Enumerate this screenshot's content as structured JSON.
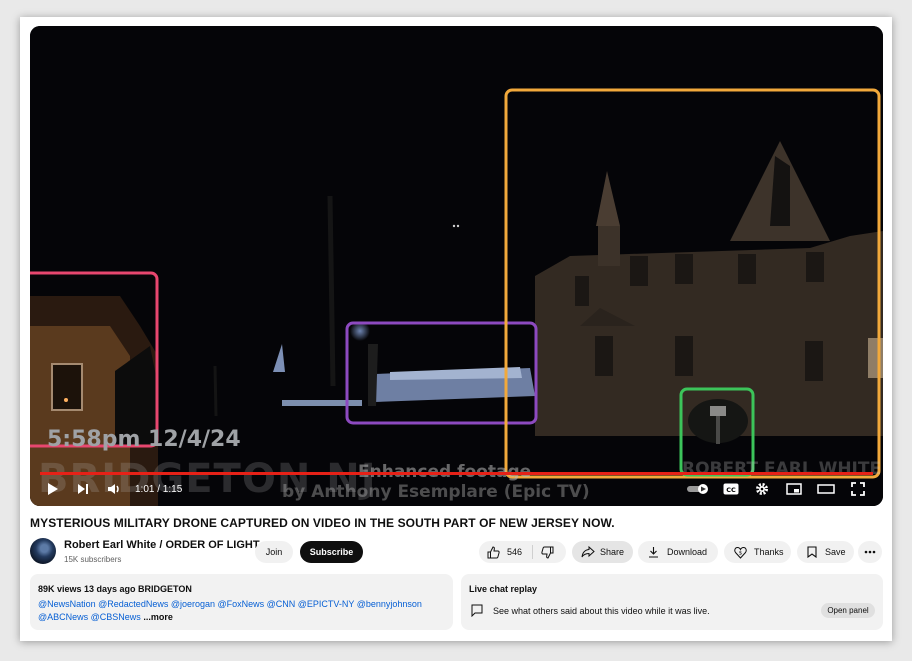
{
  "video": {
    "overlay_timestamp": "5:58pm 12/4/24",
    "overlay_location": "BRIDGETON NJ",
    "overlay_enhanced": "Enhanced footage",
    "overlay_credit": "by Anthony Esemplare (Epic TV)",
    "overlay_watermark": "ROBERT EARL WHITE",
    "time": "1:01 / 1:15",
    "progress": 1.0,
    "highlight_colors": {
      "pink": "#e8476f",
      "purple": "#8d4ac0",
      "orange": "#f2a93b",
      "green": "#3cc45a"
    },
    "controls": [
      "play-icon",
      "next-icon",
      "volume-icon",
      "autoplay-toggle",
      "captions-icon",
      "settings-icon",
      "miniplayer-icon",
      "theater-icon",
      "fullscreen-icon"
    ]
  },
  "title": "MYSTERIOUS MILITARY DRONE CAPTURED ON VIDEO IN THE SOUTH PART OF NEW JERSEY NOW.",
  "channel": {
    "name": "Robert Earl White / ORDER OF LIGHT",
    "subscribers": "15K subscribers",
    "join_label": "Join",
    "subscribe_label": "Subscribe"
  },
  "actions": {
    "likes": "546",
    "share": "Share",
    "download": "Download",
    "thanks": "Thanks",
    "save": "Save"
  },
  "description": {
    "meta": "89K views  13 days ago  BRIDGETON",
    "tags": "@NewsNation @RedactedNews @joerogan @FoxNews @CNN @EPICTV-NY @bennyjohnson @ABCNews @CBSNews",
    "more": "...more"
  },
  "chat": {
    "title": "Live chat replay",
    "text": "See what others said about this video while it was live.",
    "button": "Open panel"
  },
  "colors": {
    "subscribe_bg": "#0f0f0f",
    "progress": "#e62117",
    "link": "#065fd4"
  }
}
